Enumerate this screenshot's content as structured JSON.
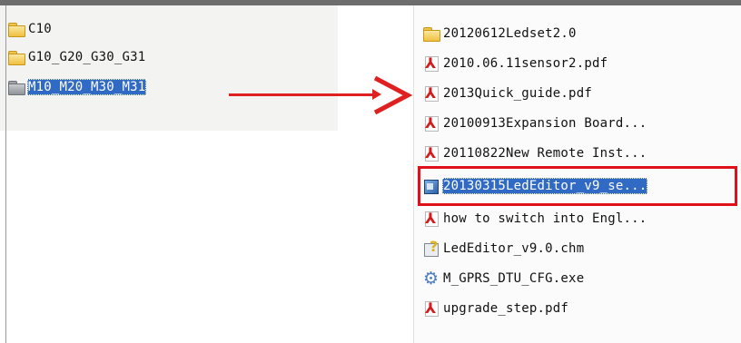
{
  "colors": {
    "selection": "#316ac5",
    "annotation": "#e02020"
  },
  "left_panel": {
    "items": [
      {
        "label": "C10",
        "icon": "folder-icon",
        "selected": false
      },
      {
        "label": "G10_G20_G30_G31",
        "icon": "folder-icon",
        "selected": false
      },
      {
        "label": "M10_M20_M30_M31",
        "icon": "folder-icon",
        "selected": true
      }
    ]
  },
  "right_panel": {
    "items": [
      {
        "label": "20120612Ledset2.0",
        "icon": "folder-icon"
      },
      {
        "label": "2010.06.11sensor2.pdf",
        "icon": "pdf-icon"
      },
      {
        "label": "2013Quick_guide.pdf",
        "icon": "pdf-icon"
      },
      {
        "label": "20100913Expansion Board...",
        "icon": "pdf-icon"
      },
      {
        "label": "20110822New Remote Inst...",
        "icon": "pdf-icon"
      },
      {
        "label": "20130315LedEditor_v9_se...",
        "icon": "installer-icon",
        "selected": true
      },
      {
        "label": "how to switch into Engl...",
        "icon": "pdf-icon"
      },
      {
        "label": "LedEditor_v9.0.chm",
        "icon": "chm-help-icon"
      },
      {
        "label": "M_GPRS_DTU_CFG.exe",
        "icon": "gear-icon"
      },
      {
        "label": "upgrade_step.pdf",
        "icon": "pdf-icon"
      }
    ]
  }
}
